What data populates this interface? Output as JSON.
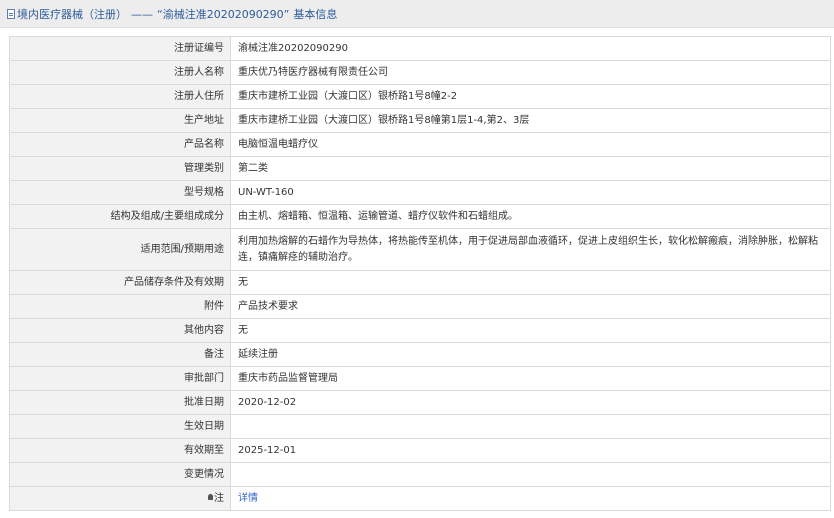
{
  "header": {
    "prefix": "境内医疗器械（注册）",
    "dash": "——",
    "record_id": "“渝械注准20202090290”",
    "suffix": "基本信息"
  },
  "rows": [
    {
      "label": "注册证编号",
      "value": "渝械注准20202090290"
    },
    {
      "label": "注册人名称",
      "value": "重庆优乃特医疗器械有限责任公司"
    },
    {
      "label": "注册人住所",
      "value": "重庆市建桥工业园（大渡口区）银桥路1号8幢2-2"
    },
    {
      "label": "生产地址",
      "value": "重庆市建桥工业园（大渡口区）银桥路1号8幢第1层1-4,第2、3层"
    },
    {
      "label": "产品名称",
      "value": "电脑恒温电蜡疗仪"
    },
    {
      "label": "管理类别",
      "value": "第二类"
    },
    {
      "label": "型号规格",
      "value": "UN-WT-160"
    },
    {
      "label": "结构及组成/主要组成成分",
      "value": "由主机、熔蜡箱、恒温箱、运输管道、蜡疗仪软件和石蜡组成。"
    },
    {
      "label": "适用范围/预期用途",
      "value": "利用加热熔解的石蜡作为导热体，将热能传至机体，用于促进局部血液循环，促进上皮组织生长，软化松解瘢痕，消除肿胀，松解粘连，镇痛解痉的辅助治疗。"
    },
    {
      "label": "产品储存条件及有效期",
      "value": "无"
    },
    {
      "label": "附件",
      "value": "产品技术要求"
    },
    {
      "label": "其他内容",
      "value": "无"
    },
    {
      "label": "备注",
      "value": "延续注册"
    },
    {
      "label": "审批部门",
      "value": "重庆市药品监督管理局"
    },
    {
      "label": "批准日期",
      "value": "2020-12-02"
    },
    {
      "label": "生效日期",
      "value": ""
    },
    {
      "label": "有效期至",
      "value": "2025-12-01"
    },
    {
      "label": "变更情况",
      "value": ""
    },
    {
      "label": "注",
      "value": "详情"
    }
  ]
}
